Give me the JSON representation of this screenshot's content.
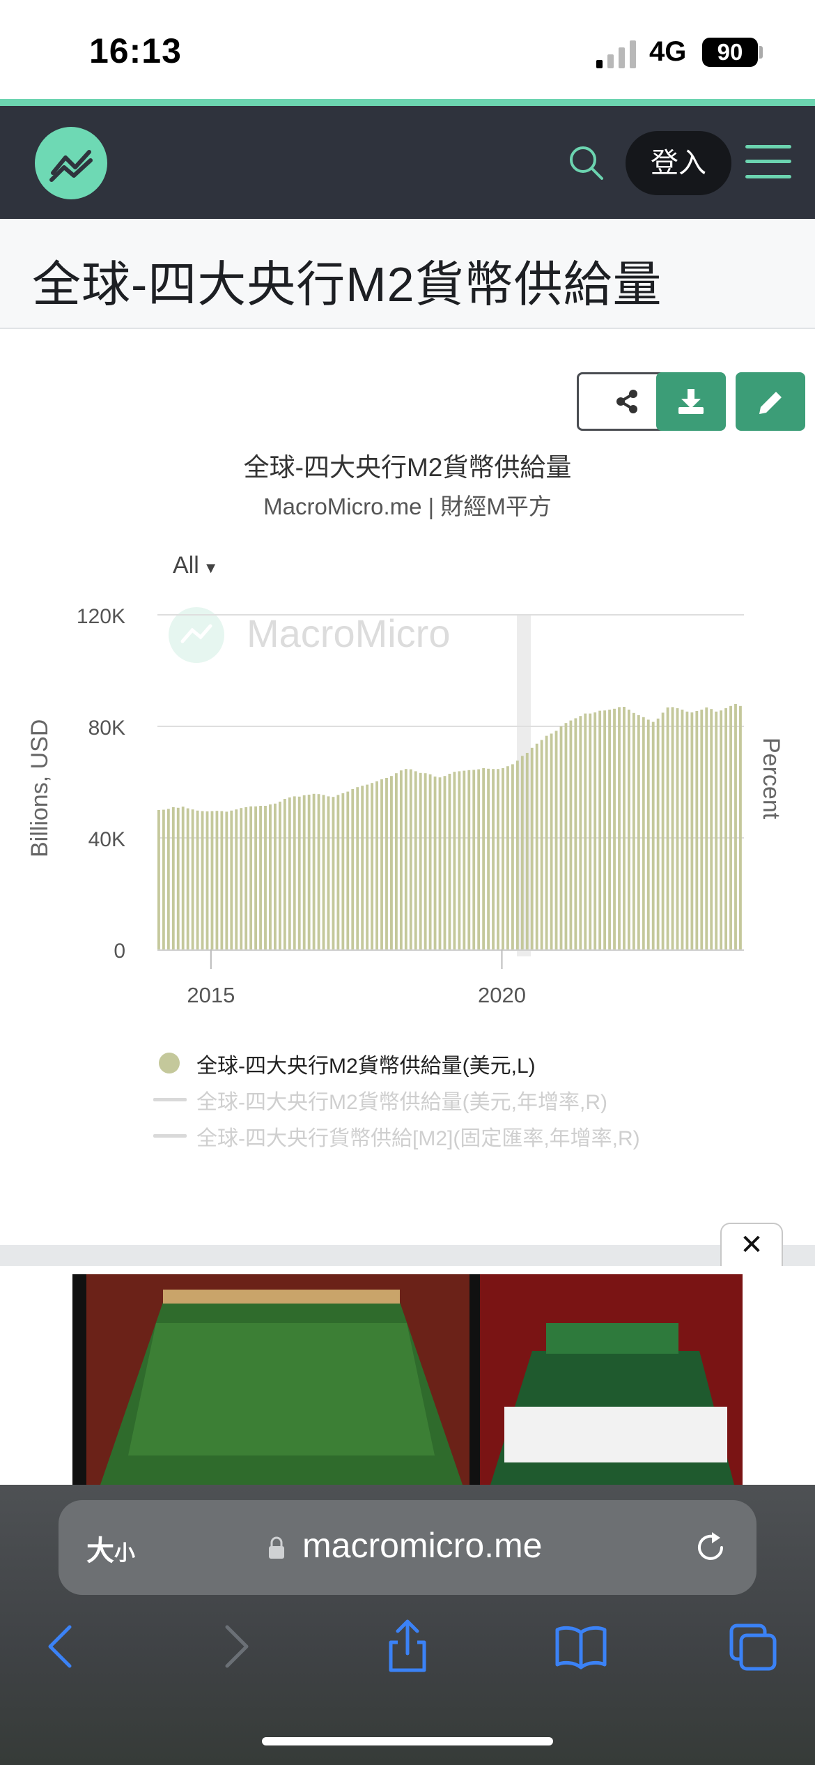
{
  "status_bar": {
    "time": "16:13",
    "network": "4G",
    "battery": "90"
  },
  "header": {
    "login_label": "登入"
  },
  "page": {
    "title": "全球-四大央行M2貨幣供給量"
  },
  "chart_header": {
    "title": "全球-四大央行M2貨幣供給量",
    "subtitle": "MacroMicro.me | 財經M平方",
    "range_selector": "All",
    "watermark": "MacroMicro"
  },
  "chart_data": {
    "type": "bar",
    "ylabel": "Billions, USD",
    "ylabel_right": "Percent",
    "yticks": [
      "0",
      "40K",
      "80K",
      "120K"
    ],
    "ylim": [
      0,
      120000
    ],
    "xticks": [
      "2015",
      "2020"
    ],
    "xlim": [
      2014.08,
      2024.16
    ],
    "bar_color": "#c4c89b",
    "series": [
      {
        "name": "全球-四大央行M2貨幣供給量(美元,L)",
        "x_start": "2014-01",
        "x_step": "month",
        "values": [
          50000,
          50100,
          50400,
          51000,
          50800,
          51200,
          50600,
          50200,
          49800,
          49600,
          49500,
          49600,
          49700,
          49600,
          49400,
          49800,
          50200,
          50700,
          51000,
          51300,
          51300,
          51500,
          51500,
          52000,
          52300,
          53000,
          54000,
          54500,
          54900,
          54800,
          55300,
          55500,
          55800,
          55700,
          55400,
          54900,
          54700,
          55400,
          56000,
          56600,
          57500,
          58200,
          58700,
          59100,
          59700,
          60300,
          61000,
          61500,
          62200,
          63200,
          64200,
          64700,
          64600,
          63900,
          63300,
          63200,
          62800,
          62000,
          61700,
          62200,
          63000,
          63700,
          63900,
          64100,
          64300,
          64400,
          64600,
          65000,
          64800,
          64700,
          64700,
          65000,
          65700,
          66400,
          67700,
          69400,
          70500,
          72300,
          73800,
          75100,
          76600,
          77400,
          78400,
          80000,
          81200,
          82100,
          82900,
          83700,
          84600,
          84600,
          85000,
          85600,
          85700,
          86000,
          86300,
          86900,
          87000,
          86000,
          84800,
          84000,
          83300,
          82400,
          81600,
          82800,
          84900,
          86800,
          86900,
          86500,
          86000,
          85300,
          85000,
          85500,
          86000,
          86800,
          86200,
          85300,
          85700,
          86500,
          87300,
          88000,
          87300
        ]
      },
      {
        "name": "全球-四大央行M2貨幣供給量(美元,年增率,R)"
      },
      {
        "name": "全球-四大央行貨幣供給[M2](固定匯率,年增率,R)"
      }
    ]
  },
  "browser": {
    "text_size_label": "大",
    "text_size_small": "小",
    "url": "macromicro.me"
  },
  "ad": {
    "close_label": "✕"
  }
}
